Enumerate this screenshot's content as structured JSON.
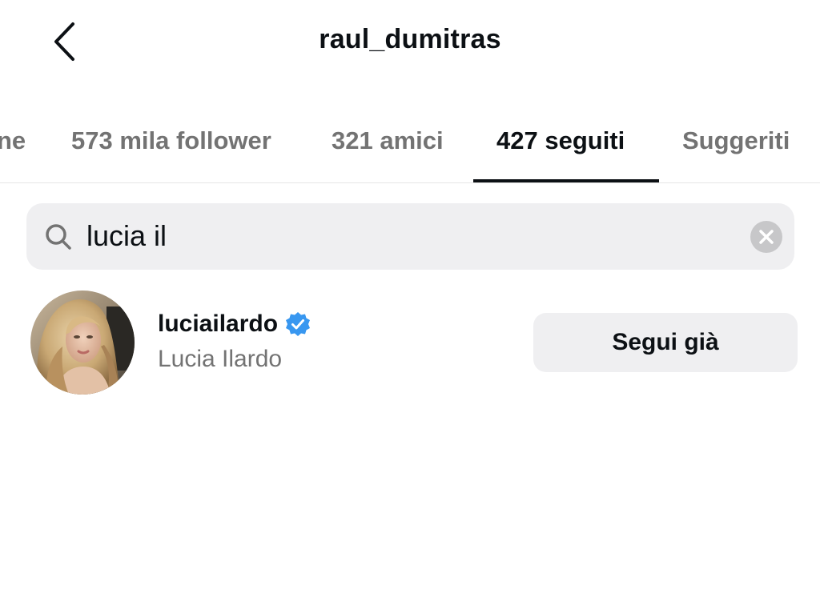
{
  "header": {
    "title": "raul_dumitras",
    "back_icon": "chevron-left-icon"
  },
  "tabs": [
    {
      "label": "ne"
    },
    {
      "label": "573 mila follower"
    },
    {
      "label": "321 amici"
    },
    {
      "label": "427 seguiti",
      "active": true
    },
    {
      "label": "Suggeriti"
    }
  ],
  "search": {
    "value": "lucia il",
    "icon": "search-icon",
    "clear_icon": "clear-icon"
  },
  "results": [
    {
      "username": "luciailardo",
      "full_name": "Lucia Ilardo",
      "verified": true,
      "button_label": "Segui già"
    }
  ],
  "colors": {
    "text_primary": "#0c1014",
    "text_secondary": "#737373",
    "verified_blue": "#3897f0",
    "button_bg": "#efeff1"
  }
}
